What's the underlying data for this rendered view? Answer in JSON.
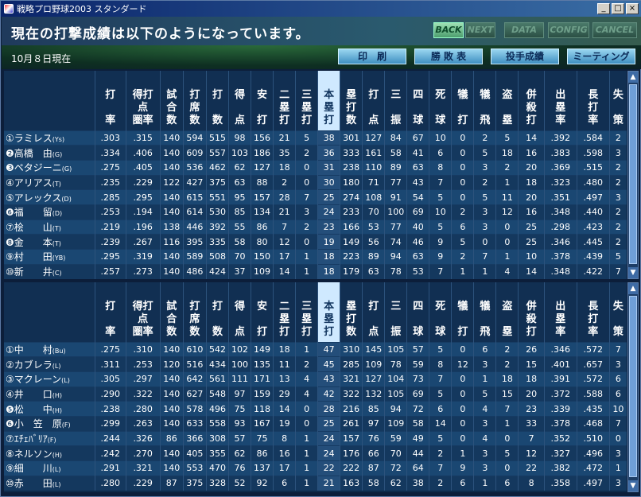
{
  "window": {
    "title": "戦略プロ野球2003 スタンダード",
    "min": "_",
    "max": "□",
    "close": "×"
  },
  "header": {
    "message": "現在の打撃成績は以下のようになっています。"
  },
  "nav": {
    "back": "BACK",
    "next": "NEXT",
    "data": "DATA",
    "config": "CONFIG",
    "cancel": "CANCEL"
  },
  "subbar": {
    "date": "10月８日現在",
    "buttons": [
      "印　刷",
      "勝 敗 表",
      "投手成績",
      "ミーティング"
    ]
  },
  "columns": [
    [
      "打",
      "",
      "率"
    ],
    [
      "得打",
      "点",
      "圏率"
    ],
    [
      "試",
      "合",
      "数"
    ],
    [
      "打",
      "席",
      "数"
    ],
    [
      "打",
      "",
      "数"
    ],
    [
      "得",
      "",
      "点"
    ],
    [
      "安",
      "",
      "打"
    ],
    [
      "二",
      "塁",
      "打"
    ],
    [
      "三",
      "塁",
      "打"
    ],
    [
      "本",
      "塁",
      "打"
    ],
    [
      "塁",
      "打",
      "数"
    ],
    [
      "打",
      "",
      "点"
    ],
    [
      "三",
      "",
      "振"
    ],
    [
      "四",
      "",
      "球"
    ],
    [
      "死",
      "",
      "球"
    ],
    [
      "犠",
      "",
      "打"
    ],
    [
      "犠",
      "",
      "飛"
    ],
    [
      "盗",
      "",
      "塁"
    ],
    [
      "併",
      "殺",
      "打"
    ],
    [
      "出",
      "塁",
      "率"
    ],
    [
      "長",
      "打",
      "率"
    ],
    [
      "失",
      "",
      "策"
    ]
  ],
  "top_rows": [
    {
      "name": "①ラミレス",
      "team": "(Ys)",
      "stats": [
        ".303",
        ".315",
        "140",
        "594",
        "515",
        "98",
        "156",
        "21",
        "5",
        "38",
        "301",
        "127",
        "84",
        "67",
        "10",
        "0",
        "2",
        "5",
        "14",
        ".392",
        ".584",
        "2"
      ]
    },
    {
      "name": "❷高橋　由",
      "team": "(G)",
      "stats": [
        ".334",
        ".406",
        "140",
        "609",
        "557",
        "103",
        "186",
        "35",
        "2",
        "36",
        "333",
        "161",
        "58",
        "41",
        "6",
        "0",
        "5",
        "18",
        "16",
        ".383",
        ".598",
        "3"
      ]
    },
    {
      "name": "❸ペタジーニ",
      "team": "(G)",
      "stats": [
        ".275",
        ".405",
        "140",
        "536",
        "462",
        "62",
        "127",
        "18",
        "0",
        "31",
        "238",
        "110",
        "89",
        "63",
        "8",
        "0",
        "3",
        "2",
        "20",
        ".369",
        ".515",
        "2"
      ]
    },
    {
      "name": "④アリアス",
      "team": "(T)",
      "stats": [
        ".235",
        ".229",
        "122",
        "427",
        "375",
        "63",
        "88",
        "2",
        "0",
        "30",
        "180",
        "71",
        "77",
        "43",
        "7",
        "0",
        "2",
        "1",
        "18",
        ".323",
        ".480",
        "2"
      ]
    },
    {
      "name": "⑤アレックス",
      "team": "(D)",
      "stats": [
        ".285",
        ".295",
        "140",
        "615",
        "551",
        "95",
        "157",
        "28",
        "7",
        "25",
        "274",
        "108",
        "91",
        "54",
        "5",
        "0",
        "5",
        "11",
        "20",
        ".351",
        ".497",
        "3"
      ]
    },
    {
      "name": "❻福　　留",
      "team": "(D)",
      "stats": [
        ".253",
        ".194",
        "140",
        "614",
        "530",
        "85",
        "134",
        "21",
        "3",
        "24",
        "233",
        "70",
        "100",
        "69",
        "10",
        "2",
        "3",
        "12",
        "16",
        ".348",
        ".440",
        "2"
      ]
    },
    {
      "name": "⑦桧　　山",
      "team": "(T)",
      "stats": [
        ".219",
        ".196",
        "138",
        "446",
        "392",
        "55",
        "86",
        "7",
        "2",
        "23",
        "166",
        "53",
        "77",
        "40",
        "5",
        "6",
        "3",
        "0",
        "25",
        ".298",
        ".423",
        "2"
      ]
    },
    {
      "name": "❽金　　本",
      "team": "(T)",
      "stats": [
        ".239",
        ".267",
        "116",
        "395",
        "335",
        "58",
        "80",
        "12",
        "0",
        "19",
        "149",
        "56",
        "74",
        "46",
        "9",
        "5",
        "0",
        "0",
        "25",
        ".346",
        ".445",
        "2"
      ]
    },
    {
      "name": "⑨村　　田",
      "team": "(YB)",
      "stats": [
        ".295",
        ".319",
        "140",
        "589",
        "508",
        "70",
        "150",
        "17",
        "1",
        "18",
        "223",
        "89",
        "94",
        "63",
        "9",
        "2",
        "7",
        "1",
        "10",
        ".378",
        ".439",
        "5"
      ]
    },
    {
      "name": "⑩新　　井",
      "team": "(C)",
      "stats": [
        ".257",
        ".273",
        "140",
        "486",
        "424",
        "37",
        "109",
        "14",
        "1",
        "18",
        "179",
        "63",
        "78",
        "53",
        "7",
        "1",
        "1",
        "4",
        "14",
        ".348",
        ".422",
        "7"
      ]
    }
  ],
  "bottom_rows": [
    {
      "name": "①中　　村",
      "team": "(Bu)",
      "stats": [
        ".275",
        ".310",
        "140",
        "610",
        "542",
        "102",
        "149",
        "18",
        "1",
        "47",
        "310",
        "145",
        "105",
        "57",
        "5",
        "0",
        "6",
        "2",
        "26",
        ".346",
        ".572",
        "7"
      ]
    },
    {
      "name": "②カブレラ",
      "team": "(L)",
      "stats": [
        ".311",
        ".253",
        "120",
        "516",
        "434",
        "100",
        "135",
        "11",
        "2",
        "45",
        "285",
        "109",
        "78",
        "59",
        "8",
        "12",
        "3",
        "2",
        "15",
        ".401",
        ".657",
        "3"
      ]
    },
    {
      "name": "③マクレーン",
      "team": "(L)",
      "stats": [
        ".305",
        ".297",
        "140",
        "642",
        "561",
        "111",
        "171",
        "13",
        "4",
        "43",
        "321",
        "127",
        "104",
        "73",
        "7",
        "0",
        "1",
        "18",
        "18",
        ".391",
        ".572",
        "6"
      ]
    },
    {
      "name": "④井　　口",
      "team": "(H)",
      "stats": [
        ".290",
        ".322",
        "140",
        "627",
        "548",
        "97",
        "159",
        "29",
        "4",
        "42",
        "322",
        "132",
        "105",
        "69",
        "5",
        "0",
        "5",
        "15",
        "20",
        ".372",
        ".588",
        "6"
      ]
    },
    {
      "name": "❺松　　中",
      "team": "(H)",
      "stats": [
        ".238",
        ".280",
        "140",
        "578",
        "496",
        "75",
        "118",
        "14",
        "0",
        "28",
        "216",
        "85",
        "94",
        "72",
        "6",
        "0",
        "4",
        "7",
        "23",
        ".339",
        ".435",
        "10"
      ]
    },
    {
      "name": "❻小　笠　原",
      "team": "(F)",
      "stats": [
        ".299",
        ".263",
        "140",
        "633",
        "558",
        "93",
        "167",
        "19",
        "0",
        "25",
        "261",
        "97",
        "109",
        "58",
        "14",
        "0",
        "3",
        "1",
        "33",
        ".378",
        ".468",
        "7"
      ]
    },
    {
      "name": "⑦ｴﾁｪﾊﾞﾘｱ",
      "team": "(F)",
      "stats": [
        ".244",
        ".326",
        "86",
        "366",
        "308",
        "57",
        "75",
        "8",
        "1",
        "24",
        "157",
        "76",
        "59",
        "49",
        "5",
        "0",
        "4",
        "0",
        "7",
        ".352",
        ".510",
        "0"
      ]
    },
    {
      "name": "⑧ネルソン",
      "team": "(H)",
      "stats": [
        ".242",
        ".270",
        "140",
        "405",
        "355",
        "62",
        "86",
        "16",
        "1",
        "24",
        "176",
        "66",
        "70",
        "44",
        "2",
        "1",
        "3",
        "5",
        "12",
        ".327",
        ".496",
        "3"
      ]
    },
    {
      "name": "⑨細　　川",
      "team": "(L)",
      "stats": [
        ".291",
        ".321",
        "140",
        "553",
        "470",
        "76",
        "137",
        "17",
        "1",
        "22",
        "222",
        "87",
        "72",
        "64",
        "7",
        "9",
        "3",
        "0",
        "22",
        ".382",
        ".472",
        "1"
      ]
    },
    {
      "name": "⑩赤　　田",
      "team": "(L)",
      "stats": [
        ".280",
        ".229",
        "87",
        "375",
        "328",
        "52",
        "92",
        "6",
        "1",
        "21",
        "163",
        "58",
        "62",
        "38",
        "2",
        "6",
        "1",
        "6",
        "8",
        ".358",
        ".497",
        "3"
      ]
    }
  ]
}
